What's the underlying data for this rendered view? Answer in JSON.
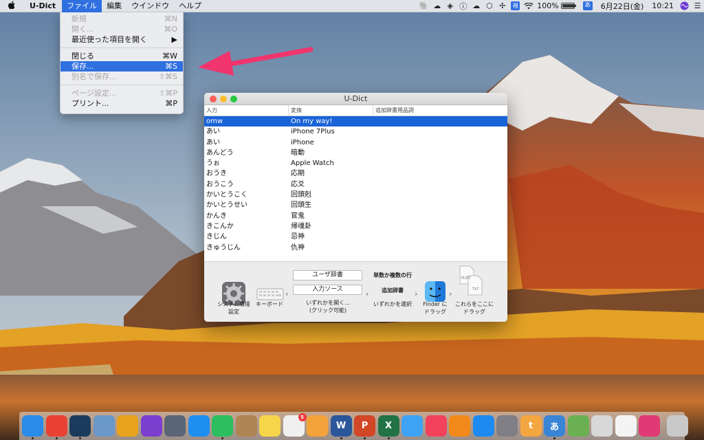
{
  "menubar": {
    "apple_icon": "apple-icon",
    "app_name": "U-Dict",
    "menus": [
      "ファイル",
      "編集",
      "ウインドウ",
      "ヘルプ"
    ],
    "active_menu": "ファイル",
    "tray_icons": [
      "evernote-icon",
      "cloud-icon",
      "dropbox-icon",
      "info-icon",
      "cloud-upload-icon",
      "vpn-icon",
      "tray-app-icon",
      "ime-kana-icon",
      "wifi-icon"
    ],
    "ime_kana": "視",
    "battery": "100%",
    "battery_level": 1.0,
    "input_source": "あ",
    "date": "6月22日(金)",
    "time": "10:21"
  },
  "file_menu": {
    "items": [
      {
        "label": "新規",
        "shortcut": "⌘N",
        "disabled": true
      },
      {
        "label": "開く...",
        "shortcut": "⌘O",
        "disabled": true
      },
      {
        "label": "最近使った項目を開く",
        "shortcut": "▶",
        "disabled": false
      },
      {
        "label": "閉じる",
        "shortcut": "⌘W",
        "disabled": false
      },
      {
        "label": "保存...",
        "shortcut": "⌘S",
        "disabled": false,
        "selected": true
      },
      {
        "label": "別名で保存...",
        "shortcut": "⇧⌘S",
        "disabled": true
      },
      {
        "label": "ページ設定...",
        "shortcut": "⇧⌘P",
        "disabled": true
      },
      {
        "label": "プリント...",
        "shortcut": "⌘P",
        "disabled": false
      }
    ]
  },
  "window": {
    "title": "U-Dict",
    "columns": [
      "入力",
      "変換",
      "追加辞書用品詞"
    ],
    "rows": [
      {
        "input": "omw",
        "conversion": "On my way!",
        "pos": "",
        "selected": true
      },
      {
        "input": "あい",
        "conversion": "iPhone 7Plus",
        "pos": ""
      },
      {
        "input": "あい",
        "conversion": "iPhone",
        "pos": ""
      },
      {
        "input": "あんどう",
        "conversion": "暗動",
        "pos": ""
      },
      {
        "input": "うぉ",
        "conversion": "Apple Watch",
        "pos": ""
      },
      {
        "input": "おうき",
        "conversion": "応期",
        "pos": ""
      },
      {
        "input": "おうこう",
        "conversion": "応爻",
        "pos": ""
      },
      {
        "input": "かいとうこく",
        "conversion": "回頭剋",
        "pos": ""
      },
      {
        "input": "かいとうせい",
        "conversion": "回頭生",
        "pos": ""
      },
      {
        "input": "かんき",
        "conversion": "官鬼",
        "pos": ""
      },
      {
        "input": "きこんか",
        "conversion": "帰魂卦",
        "pos": ""
      },
      {
        "input": "きじん",
        "conversion": "忌神",
        "pos": ""
      },
      {
        "input": "きゅうじん",
        "conversion": "仇神",
        "pos": ""
      }
    ],
    "guide": {
      "system_prefs": "システム環境\n設定",
      "keyboard": "キーボード",
      "user_dict": "ユーザ辞書",
      "input_source": "入力ソース",
      "either_open": "いずれかを開く...\n(クリック可能)",
      "single_multi": "単数か複数の行",
      "add_dict": "追加辞書",
      "either_select": "いずれかを選択",
      "finder_drag": "Finder に\nドラッグ",
      "drag_here": "これらをここに\nドラッグ",
      "file_plist": "PLIST",
      "file_txt": "TXT"
    }
  },
  "dock": {
    "apps": [
      {
        "name": "finder-icon",
        "color": "#2a8be8",
        "running": true
      },
      {
        "name": "chrome-icon",
        "color": "#e94235",
        "running": true
      },
      {
        "name": "kindle-icon",
        "color": "#1b3b5c",
        "running": true
      },
      {
        "name": "preview-icon",
        "color": "#6a98c9",
        "running": false
      },
      {
        "name": "butterfly-icon",
        "color": "#e8a21b",
        "running": false
      },
      {
        "name": "siri-icon",
        "color": "#7b3fcf",
        "running": false
      },
      {
        "name": "launchpad-icon",
        "color": "#5a6576",
        "running": false
      },
      {
        "name": "safari-icon",
        "color": "#1f8ef1",
        "running": false
      },
      {
        "name": "evernote-icon",
        "color": "#2dbe60",
        "running": true
      },
      {
        "name": "notebook-icon",
        "color": "#b08554",
        "running": false
      },
      {
        "name": "notes-icon",
        "color": "#f6d54b",
        "running": false
      },
      {
        "name": "reminders-icon",
        "color": "#f0f0f0",
        "running": false,
        "badge": "5"
      },
      {
        "name": "photos-icon",
        "color": "#f3a33a",
        "running": false
      },
      {
        "name": "word-icon",
        "color": "#2b579a",
        "running": true,
        "text": "W"
      },
      {
        "name": "powerpoint-icon",
        "color": "#d24726",
        "running": true,
        "text": "P"
      },
      {
        "name": "excel-icon",
        "color": "#217346",
        "running": true,
        "text": "X"
      },
      {
        "name": "messages-icon",
        "color": "#3fa3f5",
        "running": false
      },
      {
        "name": "music-icon",
        "color": "#f2415b",
        "running": false
      },
      {
        "name": "books-icon",
        "color": "#f28a1b",
        "running": false
      },
      {
        "name": "app-store-icon",
        "color": "#1d8af1",
        "running": false
      },
      {
        "name": "system-preferences-icon",
        "color": "#7f7f85",
        "running": false
      },
      {
        "name": "textwrangler-icon",
        "color": "#f4a640",
        "running": false,
        "text": "t"
      },
      {
        "name": "udict-icon",
        "color": "#3b85d6",
        "running": true,
        "text": "あ"
      },
      {
        "name": "maps-icon",
        "color": "#6bb052",
        "running": false
      },
      {
        "name": "archive-icon",
        "color": "#d8d8d8",
        "running": false
      },
      {
        "name": "document-icon",
        "color": "#f4f4f4",
        "running": false
      },
      {
        "name": "lips-icon",
        "color": "#e03a74",
        "running": false
      },
      {
        "name": "trash-icon",
        "color": "#c9c9c9",
        "running": false
      }
    ]
  }
}
